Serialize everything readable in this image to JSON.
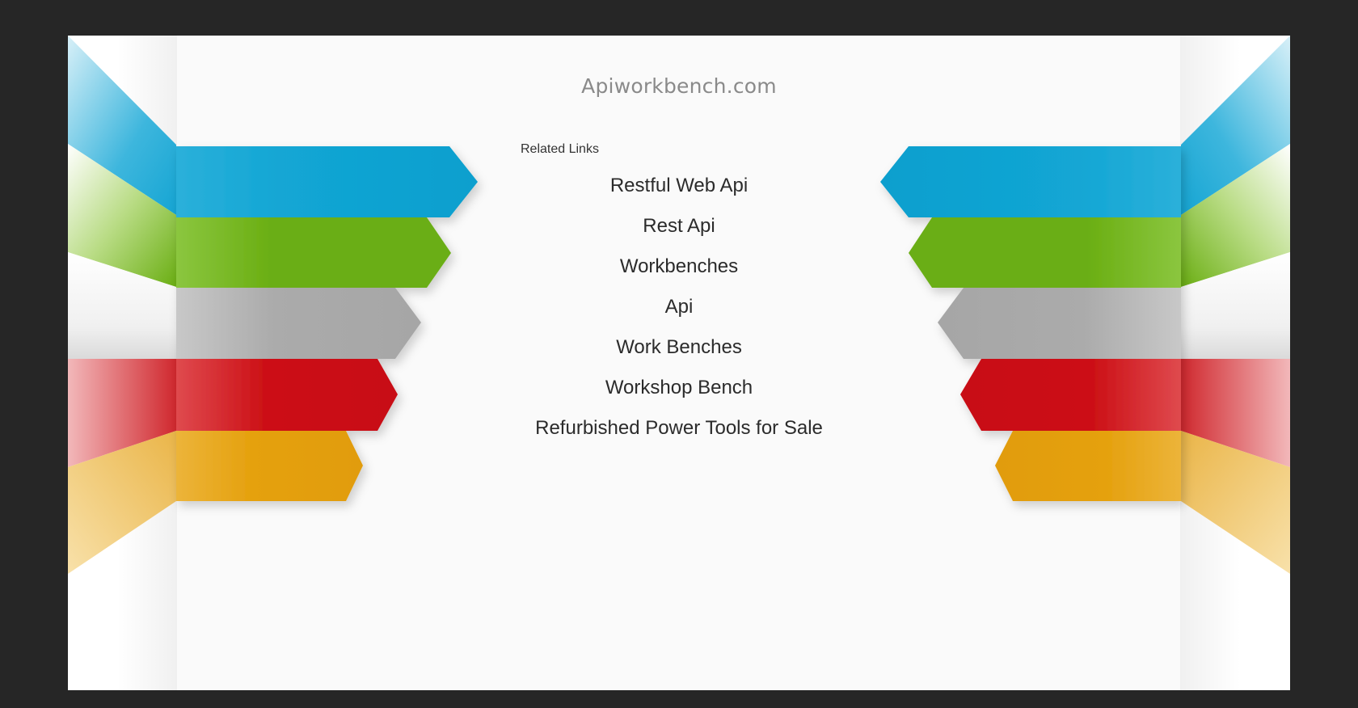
{
  "site": {
    "title": "Apiworkbench.com"
  },
  "related": {
    "heading": "Related Links",
    "links": [
      "Restful Web Api",
      "Rest Api",
      "Workbenches",
      "Api",
      "Work Benches",
      "Workshop Bench",
      "Refurbished Power Tools for Sale"
    ]
  },
  "colors": {
    "background": "#262626",
    "panel": "#fafafa",
    "ribbon_blue": "#12a6d4",
    "ribbon_green": "#6aae12",
    "ribbon_gray": "#aaaaaa",
    "ribbon_red": "#cc1016",
    "ribbon_orange": "#e5a10e"
  }
}
